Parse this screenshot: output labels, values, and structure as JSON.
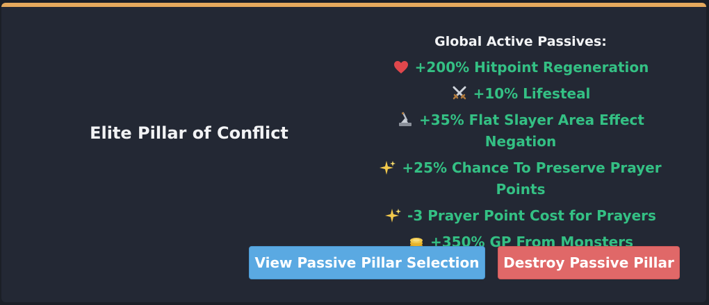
{
  "pillar": {
    "name": "Elite Pillar of Conflict"
  },
  "passives": {
    "title": "Global Active Passives:",
    "items": [
      {
        "icon": "heart-icon",
        "text": "+200% Hitpoint Regeneration"
      },
      {
        "icon": "crossed-swords-icon",
        "text": "+10% Lifesteal"
      },
      {
        "icon": "slayer-icon",
        "text": "+35% Flat Slayer Area Effect Negation"
      },
      {
        "icon": "sparkle-icon",
        "text": "+25% Chance To Preserve Prayer Points"
      },
      {
        "icon": "sparkle-icon",
        "text": "-3 Prayer Point Cost for Prayers"
      },
      {
        "icon": "coins-icon",
        "text": "+350% GP From Monsters"
      }
    ]
  },
  "buttons": {
    "view_label": "View Passive Pillar Selection",
    "destroy_label": "Destroy Passive Pillar"
  },
  "colors": {
    "accent_top": "#e5a95d",
    "passive_text": "#34c084",
    "view_button": "#5aa9e2",
    "destroy_button": "#e06868"
  }
}
